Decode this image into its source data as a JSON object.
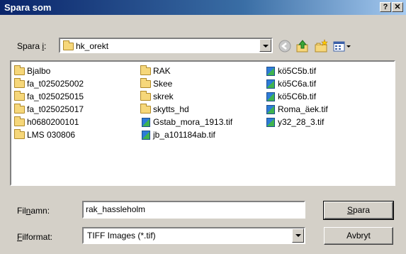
{
  "titlebar": {
    "title": "Spara som",
    "help_label": "?",
    "close_label": "✕"
  },
  "location": {
    "label_prefix": "Spara ",
    "label_mnemonic": "i",
    "label_suffix": ":",
    "folder": "hk_orekt"
  },
  "toolbar": {
    "back_icon": "back-icon",
    "up_icon": "folder-up-icon",
    "new_folder_icon": "new-folder-icon",
    "view_icon": "view-menu-icon"
  },
  "files": {
    "col1": [
      "Bjalbo",
      "fa_t025025002",
      "fa_t025025015",
      "fa_t025025017",
      "h0680200101",
      "LMS 030806"
    ],
    "col2_folders": [
      "RAK",
      "Skee",
      "skrek",
      "skytts_hd"
    ],
    "col2_files": [
      "Gstab_mora_1913.tif",
      "jb_a101184ab.tif"
    ],
    "col3": [
      "kö5C5b.tif",
      "kö5C6a.tif",
      "kö5C6b.tif",
      "Roma_äek.tif",
      "y32_28_3.tif"
    ]
  },
  "filename": {
    "label_pre": "Fil",
    "label_mnemonic": "n",
    "label_post": "amn:",
    "value": "rak_hassleholm"
  },
  "filetype": {
    "label_mnemonic": "F",
    "label_post": "ilformat:",
    "value": "TIFF Images (*.tif)"
  },
  "buttons": {
    "save_mnemonic": "S",
    "save_rest": "para",
    "cancel": "Avbryt"
  }
}
